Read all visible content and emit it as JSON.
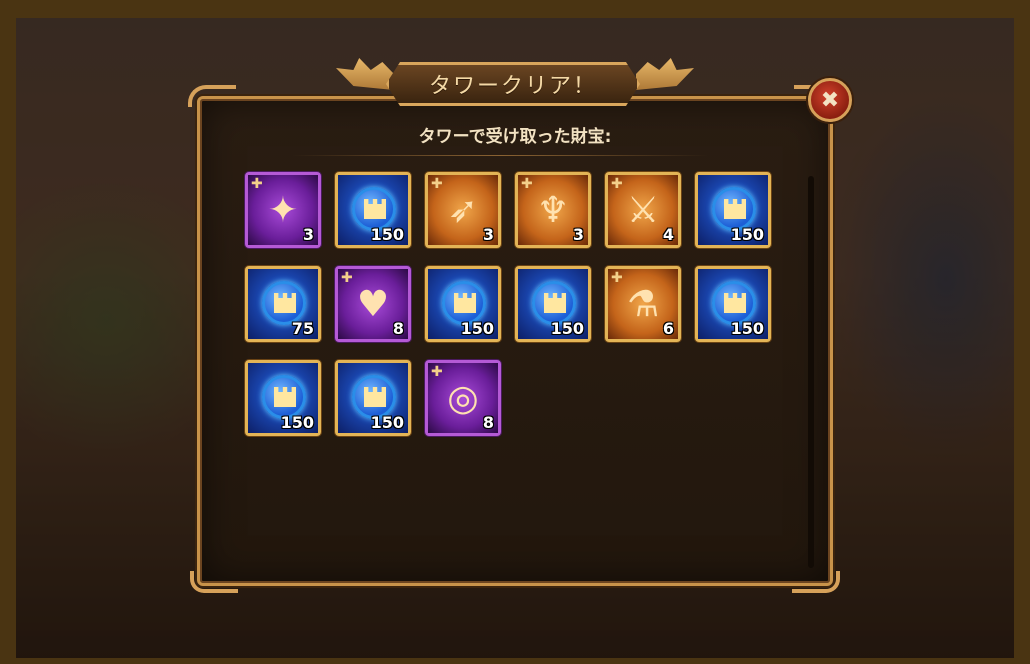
{
  "dialog": {
    "title": "タワークリア！",
    "subtitle": "タワーで受け取った財宝:",
    "close_label": "✖"
  },
  "rewards": [
    {
      "name": "artifact-totem",
      "frame": "purple",
      "art": "violet",
      "icon": "✦",
      "fragment": true,
      "qty": "3"
    },
    {
      "name": "tower-coin",
      "frame": "gold",
      "art": "coin",
      "icon": "tower-coin-icon",
      "fragment": false,
      "qty": "150"
    },
    {
      "name": "phoenix-feather",
      "frame": "gold",
      "art": "orange",
      "icon": "➶",
      "fragment": true,
      "qty": "3"
    },
    {
      "name": "golden-horn",
      "frame": "gold",
      "art": "orange",
      "icon": "♆",
      "fragment": true,
      "qty": "3"
    },
    {
      "name": "fire-daggers",
      "frame": "gold",
      "art": "orange",
      "icon": "⚔",
      "fragment": true,
      "qty": "4"
    },
    {
      "name": "tower-coin",
      "frame": "gold",
      "art": "coin",
      "icon": "tower-coin-icon",
      "fragment": false,
      "qty": "150"
    },
    {
      "name": "tower-coin",
      "frame": "gold",
      "art": "coin",
      "icon": "tower-coin-icon",
      "fragment": false,
      "qty": "75"
    },
    {
      "name": "ruby-heart",
      "frame": "purple",
      "art": "violet",
      "icon": "♥",
      "fragment": true,
      "qty": "8"
    },
    {
      "name": "tower-coin",
      "frame": "gold",
      "art": "coin",
      "icon": "tower-coin-icon",
      "fragment": false,
      "qty": "150"
    },
    {
      "name": "tower-coin",
      "frame": "gold",
      "art": "coin",
      "icon": "tower-coin-icon",
      "fragment": false,
      "qty": "150"
    },
    {
      "name": "potion-belt",
      "frame": "gold",
      "art": "orange",
      "icon": "⚗",
      "fragment": true,
      "qty": "6"
    },
    {
      "name": "tower-coin",
      "frame": "gold",
      "art": "coin",
      "icon": "tower-coin-icon",
      "fragment": false,
      "qty": "150"
    },
    {
      "name": "tower-coin",
      "frame": "gold",
      "art": "coin",
      "icon": "tower-coin-icon",
      "fragment": false,
      "qty": "150"
    },
    {
      "name": "tower-coin",
      "frame": "gold",
      "art": "coin",
      "icon": "tower-coin-icon",
      "fragment": false,
      "qty": "150"
    },
    {
      "name": "silver-ring",
      "frame": "purple",
      "art": "violet",
      "icon": "◎",
      "fragment": true,
      "qty": "8"
    }
  ],
  "colors": {
    "gold_frame": "#e3b456",
    "purple_frame": "#b55ad6",
    "panel_border": "#c8934a",
    "close_red": "#d2422c"
  }
}
